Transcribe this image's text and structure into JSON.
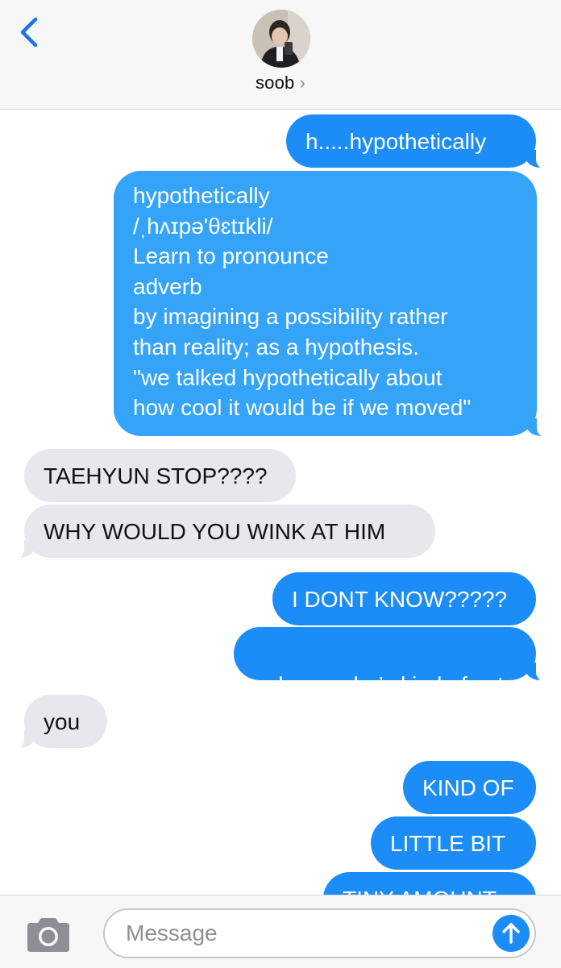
{
  "header": {
    "contact_name": "soob",
    "chevron": "›",
    "back_icon": "chevron-left-icon"
  },
  "messages": [
    {
      "side": "sent",
      "text": "h.....hypothetically"
    },
    {
      "side": "sent",
      "lines": [
        "hypothetically",
        "/ˌhʌɪpə'θɛtɪkli/",
        " Learn to pronounce",
        "adverb",
        "by imagining a possibility rather",
        "than reality; as a hypothesis.",
        "\"we talked hypothetically about",
        "how cool it would be if we moved\""
      ]
    },
    {
      "side": "received",
      "text": "TAEHYUN STOP????"
    },
    {
      "side": "received",
      "text": "WHY WOULD YOU WINK AT HIM"
    },
    {
      "side": "sent",
      "text": "I DONT KNOW?????"
    },
    {
      "side": "sent",
      "text": "he      . he’s kind of cute"
    },
    {
      "side": "received",
      "text": "you"
    },
    {
      "side": "sent",
      "text": "KIND OF"
    },
    {
      "side": "sent",
      "text": "LITTLE BIT"
    },
    {
      "side": "sent",
      "text": "TINY AMOUNT"
    }
  ],
  "composer": {
    "placeholder": "Message",
    "camera_icon": "camera-icon",
    "send_icon": "arrow-up-icon"
  },
  "colors": {
    "sent_bubble": "#1c8cf7",
    "received_bubble": "#e7e7ec",
    "accent": "#1a73e8"
  }
}
